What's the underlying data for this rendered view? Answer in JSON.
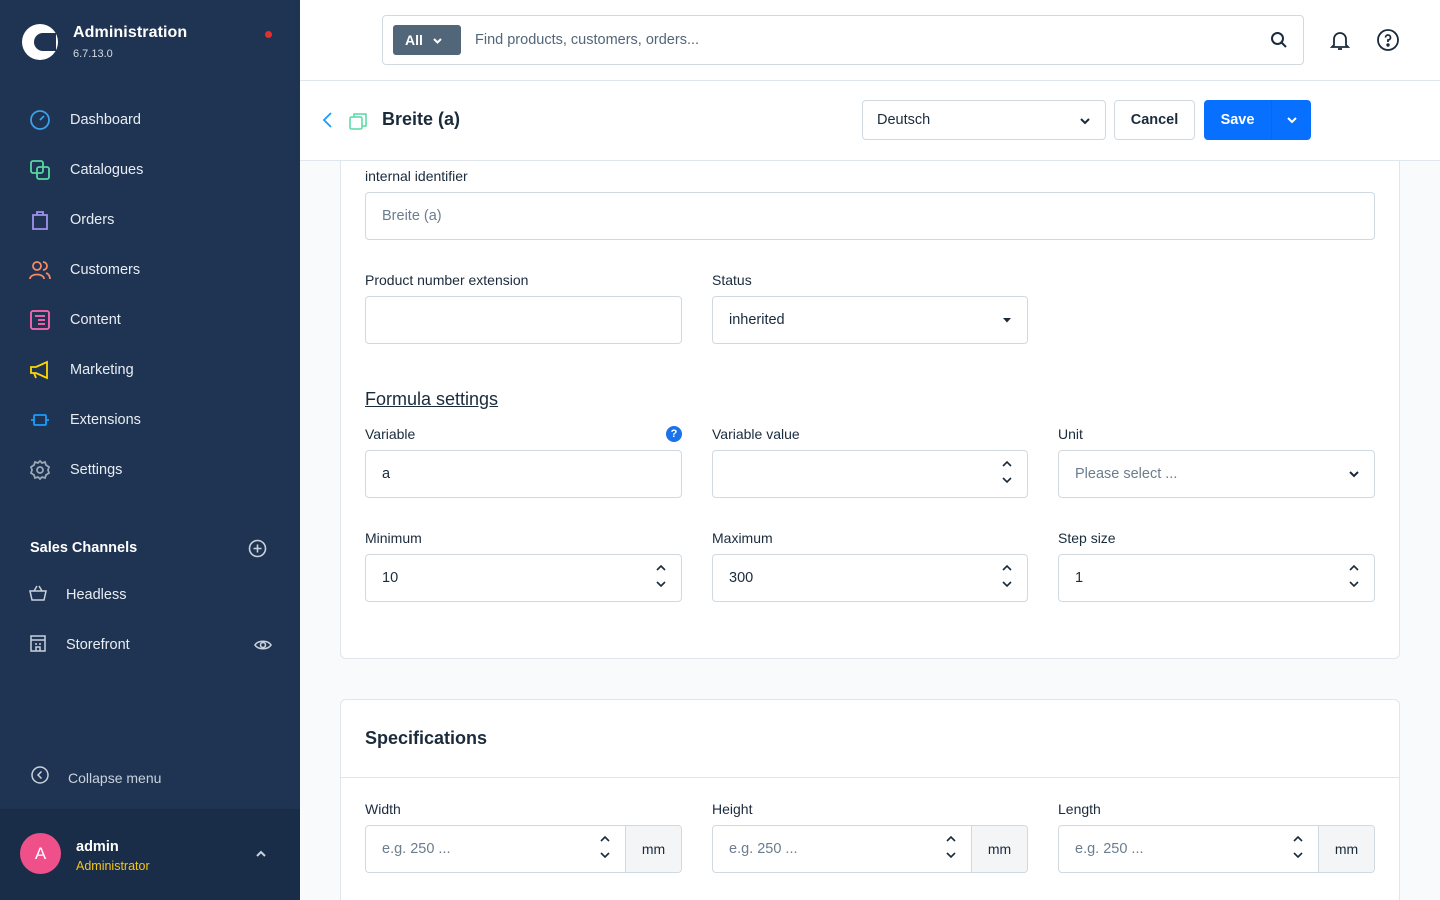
{
  "app": {
    "title": "Administration",
    "version": "6.7.13.0"
  },
  "sidebar": {
    "items": [
      {
        "label": "Dashboard",
        "icon": "dashboard-icon",
        "color": "#3aa0e8"
      },
      {
        "label": "Catalogues",
        "icon": "catalogues-icon",
        "color": "#57d9a3"
      },
      {
        "label": "Orders",
        "icon": "orders-icon",
        "color": "#a092f0"
      },
      {
        "label": "Customers",
        "icon": "customers-icon",
        "color": "#f88962"
      },
      {
        "label": "Content",
        "icon": "content-icon",
        "color": "#ff68b4"
      },
      {
        "label": "Marketing",
        "icon": "marketing-icon",
        "color": "#ffd700"
      },
      {
        "label": "Extensions",
        "icon": "extensions-icon",
        "color": "#189eff"
      },
      {
        "label": "Settings",
        "icon": "settings-icon",
        "color": "#9aa8b5"
      }
    ],
    "sales_channels_title": "Sales Channels",
    "sales_channels": [
      {
        "label": "Headless"
      },
      {
        "label": "Storefront"
      }
    ],
    "collapse_label": "Collapse menu"
  },
  "user": {
    "initial": "A",
    "name": "admin",
    "role": "Administrator"
  },
  "search": {
    "scope": "All",
    "placeholder": "Find products, customers, orders..."
  },
  "smartbar": {
    "title": "Breite (a)",
    "language": "Deutsch",
    "cancel_label": "Cancel",
    "save_label": "Save"
  },
  "form": {
    "internal_identifier": {
      "label": "internal identifier",
      "placeholder": "Breite (a)"
    },
    "product_number_extension": {
      "label": "Product number extension",
      "value": ""
    },
    "status": {
      "label": "Status",
      "value": "inherited"
    },
    "formula_heading": "Formula settings",
    "variable": {
      "label": "Variable",
      "value": "a",
      "help": "?"
    },
    "variable_value": {
      "label": "Variable value",
      "value": ""
    },
    "unit": {
      "label": "Unit",
      "placeholder": "Please select ..."
    },
    "minimum": {
      "label": "Minimum",
      "value": "10"
    },
    "maximum": {
      "label": "Maximum",
      "value": "300"
    },
    "step_size": {
      "label": "Step size",
      "value": "1"
    }
  },
  "specifications": {
    "title": "Specifications",
    "width": {
      "label": "Width",
      "placeholder": "e.g. 250 ...",
      "unit": "mm"
    },
    "height": {
      "label": "Height",
      "placeholder": "e.g. 250 ...",
      "unit": "mm"
    },
    "length": {
      "label": "Length",
      "placeholder": "e.g. 250 ...",
      "unit": "mm"
    }
  },
  "colors": {
    "sidebar_bg": "#1f3452",
    "primary": "#0870ff",
    "avatar": "#f0508a",
    "role": "#f5c518"
  }
}
